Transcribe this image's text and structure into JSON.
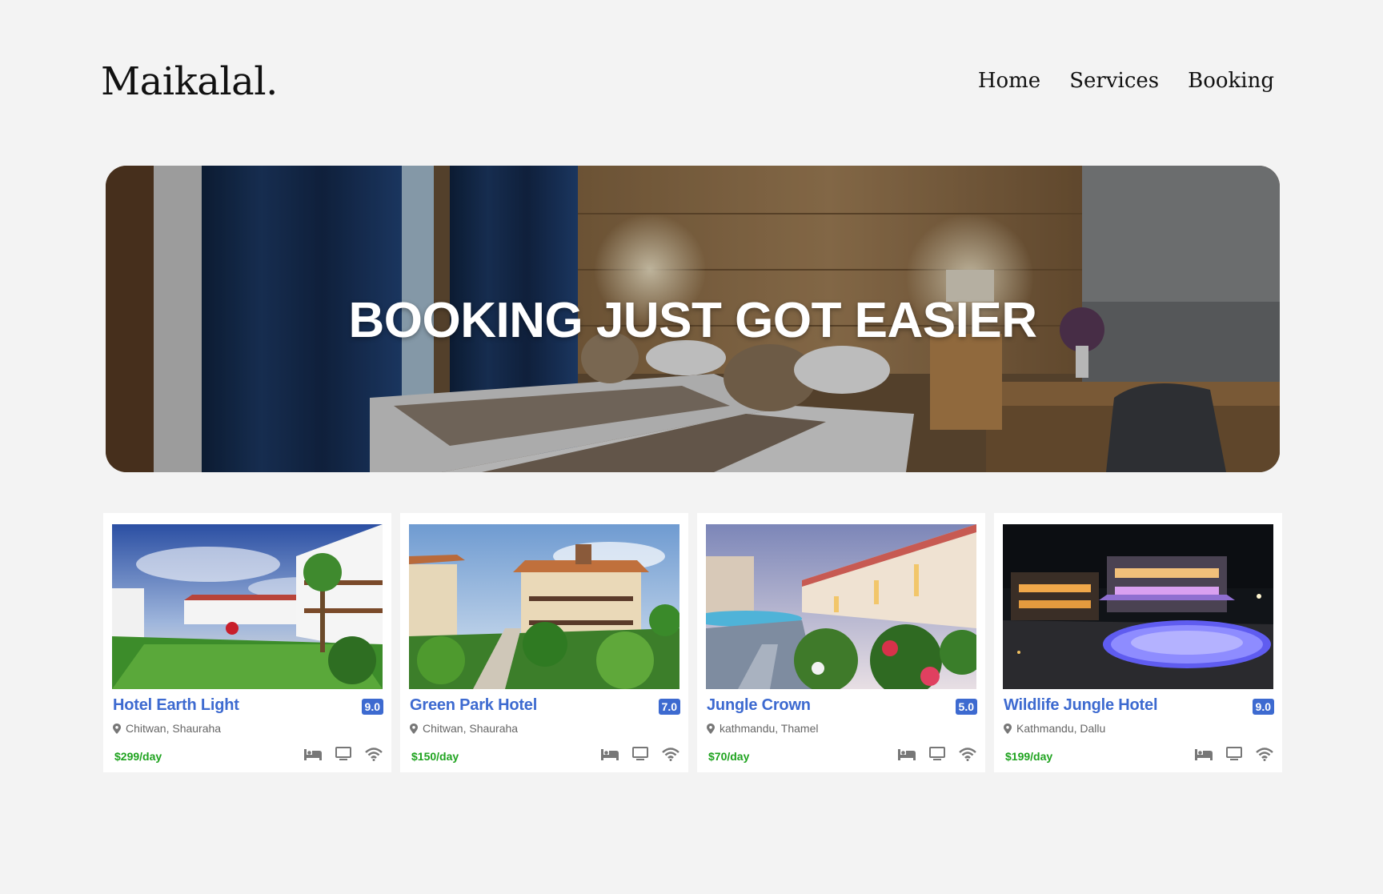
{
  "brand": {
    "logo": "Maikalal."
  },
  "nav": {
    "items": [
      {
        "label": "Home"
      },
      {
        "label": "Services"
      },
      {
        "label": "Booking"
      }
    ]
  },
  "hero": {
    "title": "BOOKING JUST GOT EASIER",
    "image": "hotel-room-photo"
  },
  "hotels": [
    {
      "name": "Hotel Earth Light",
      "rating": "9.0",
      "location": "Chitwan, Shauraha",
      "price": "$299/day",
      "image": "resort-lawn-photo",
      "amenities": [
        "bed-icon",
        "tv-icon",
        "wifi-icon"
      ]
    },
    {
      "name": "Green Park Hotel",
      "rating": "7.0",
      "location": "Chitwan, Shauraha",
      "price": "$150/day",
      "image": "garden-villa-photo",
      "amenities": [
        "bed-icon",
        "tv-icon",
        "wifi-icon"
      ]
    },
    {
      "name": "Jungle Crown",
      "rating": "5.0",
      "location": "kathmandu, Thamel",
      "price": "$70/day",
      "image": "pool-terrace-photo",
      "amenities": [
        "bed-icon",
        "tv-icon",
        "wifi-icon"
      ]
    },
    {
      "name": "Wildlife Jungle Hotel",
      "rating": "9.0",
      "location": "Kathmandu, Dallu",
      "price": "$199/day",
      "image": "night-pool-photo",
      "amenities": [
        "bed-icon",
        "tv-icon",
        "wifi-icon"
      ]
    }
  ],
  "colors": {
    "background": "#f3f3f3",
    "accent": "#3d6ad0",
    "price": "#1fa31f",
    "icon": "#777777"
  }
}
